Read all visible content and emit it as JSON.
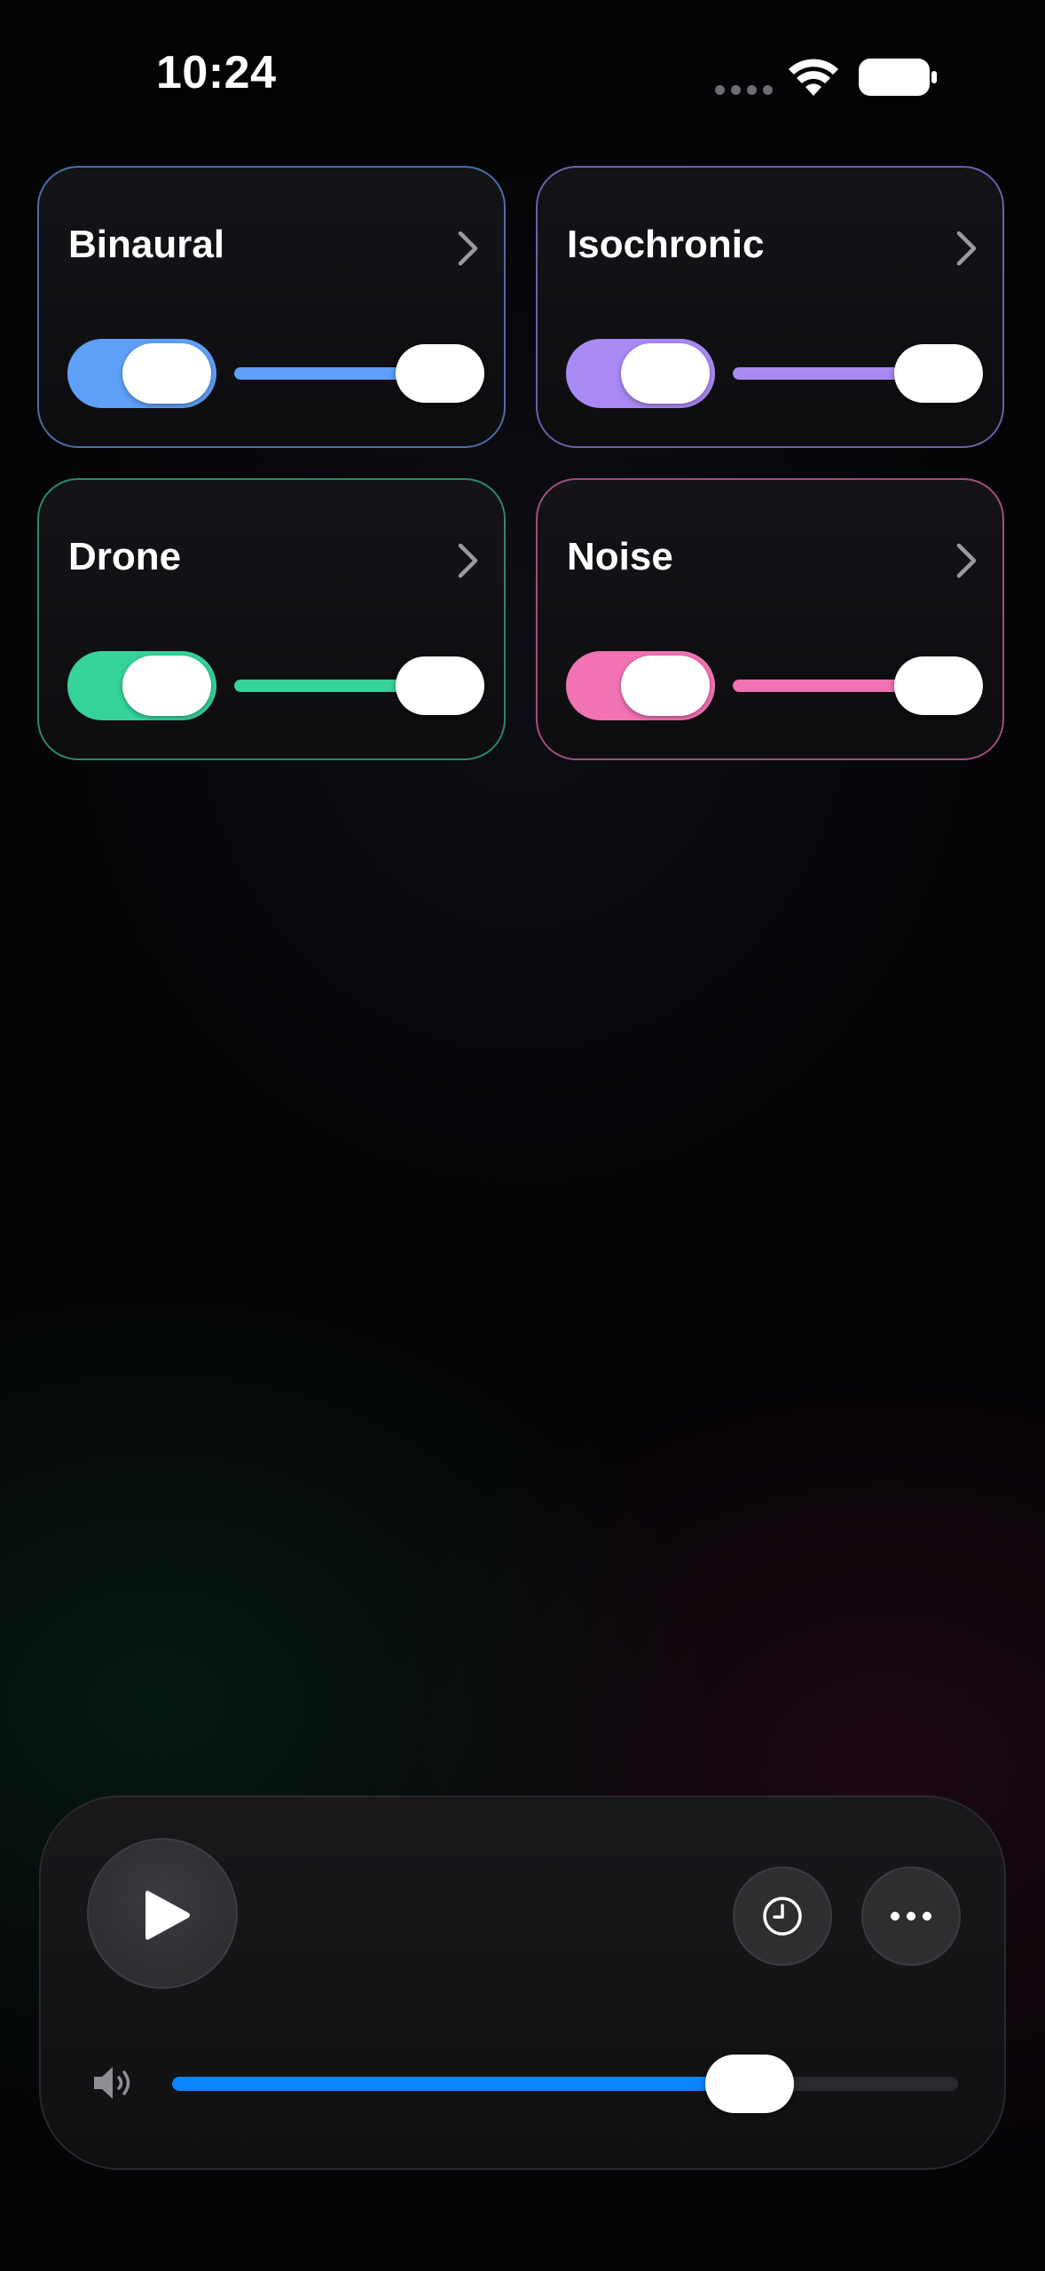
{
  "status_bar": {
    "time": "10:24",
    "icons": [
      "cellular-signal-icon",
      "wifi-icon",
      "battery-icon"
    ]
  },
  "cards": [
    {
      "id": "binaural",
      "title": "Binaural",
      "color": "#5fa0f8",
      "border": "#4a6fa8",
      "enabled": true,
      "level": 1.0
    },
    {
      "id": "isochronic",
      "title": "Isochronic",
      "color": "#a98af5",
      "border": "#6f5fa8",
      "enabled": true,
      "level": 1.0
    },
    {
      "id": "drone",
      "title": "Drone",
      "color": "#35d39a",
      "border": "#2e8a66",
      "enabled": true,
      "level": 1.0
    },
    {
      "id": "noise",
      "title": "Noise",
      "color": "#f273b4",
      "border": "#a44d7e",
      "enabled": true,
      "level": 1.0
    }
  ],
  "player": {
    "icons": [
      "play-icon",
      "clock-icon",
      "more-icon",
      "speaker-icon"
    ],
    "volume_level": 0.765,
    "accent": "#0a84ff"
  }
}
